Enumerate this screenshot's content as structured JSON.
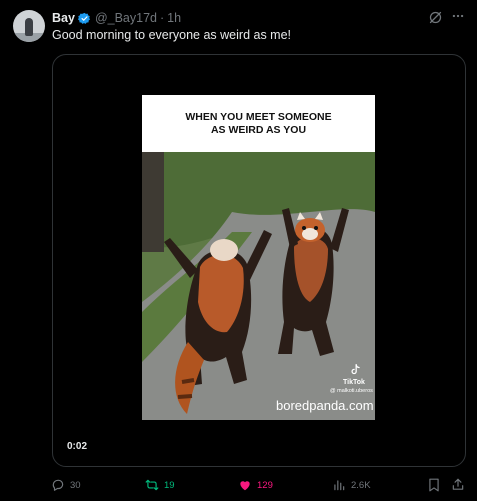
{
  "tweet": {
    "display_name": "Bay",
    "handle": "@_Bay17d",
    "separator": "·",
    "time": "1h",
    "text": "Good morning to everyone as weird as me!",
    "verified_color": "#1d9bf0"
  },
  "media": {
    "caption": "WHEN YOU MEET SOMEONE AS WEIRD AS YOU",
    "tiktok_label": "TikTok",
    "tiktok_user": "@ malkoti.uberos",
    "watermark": "boredpanda.com",
    "duration": "0:02"
  },
  "actions": {
    "reply_count": "30",
    "retweet_count": "19",
    "like_count": "129",
    "view_count": "2.6K",
    "retweet_color": "#00ba7c",
    "like_color": "#f91880"
  },
  "icons": [
    "grok-icon",
    "more-icon",
    "verified-badge-icon",
    "reply-icon",
    "retweet-icon",
    "heart-icon",
    "views-icon",
    "bookmark-icon",
    "share-icon",
    "tiktok-icon"
  ]
}
